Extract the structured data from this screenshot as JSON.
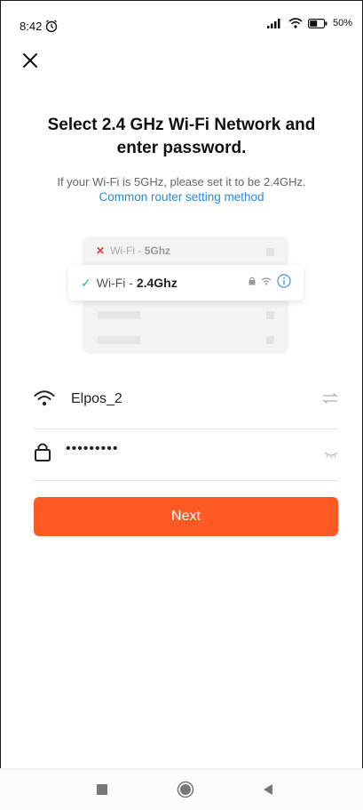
{
  "status_bar": {
    "time": "8:42",
    "battery": "50%"
  },
  "title": "Select 2.4 GHz Wi-Fi Network and enter password.",
  "subtitle": "If your Wi-Fi is 5GHz, please set it to be 2.4GHz.",
  "router_link": "Common router setting method",
  "illustration": {
    "row_5g_prefix": "Wi-Fi - ",
    "row_5g_band": "5Ghz",
    "row_24g_prefix": "Wi-Fi - ",
    "row_24g_band": "2.4Ghz"
  },
  "wifi_field": {
    "value": "Elpos_2"
  },
  "password_field": {
    "value": "•••••••••"
  },
  "next_label": "Next",
  "colors": {
    "accent": "#ff5a23",
    "link": "#2a8ad8",
    "check": "#28b2a8",
    "error": "#e03a3a"
  }
}
